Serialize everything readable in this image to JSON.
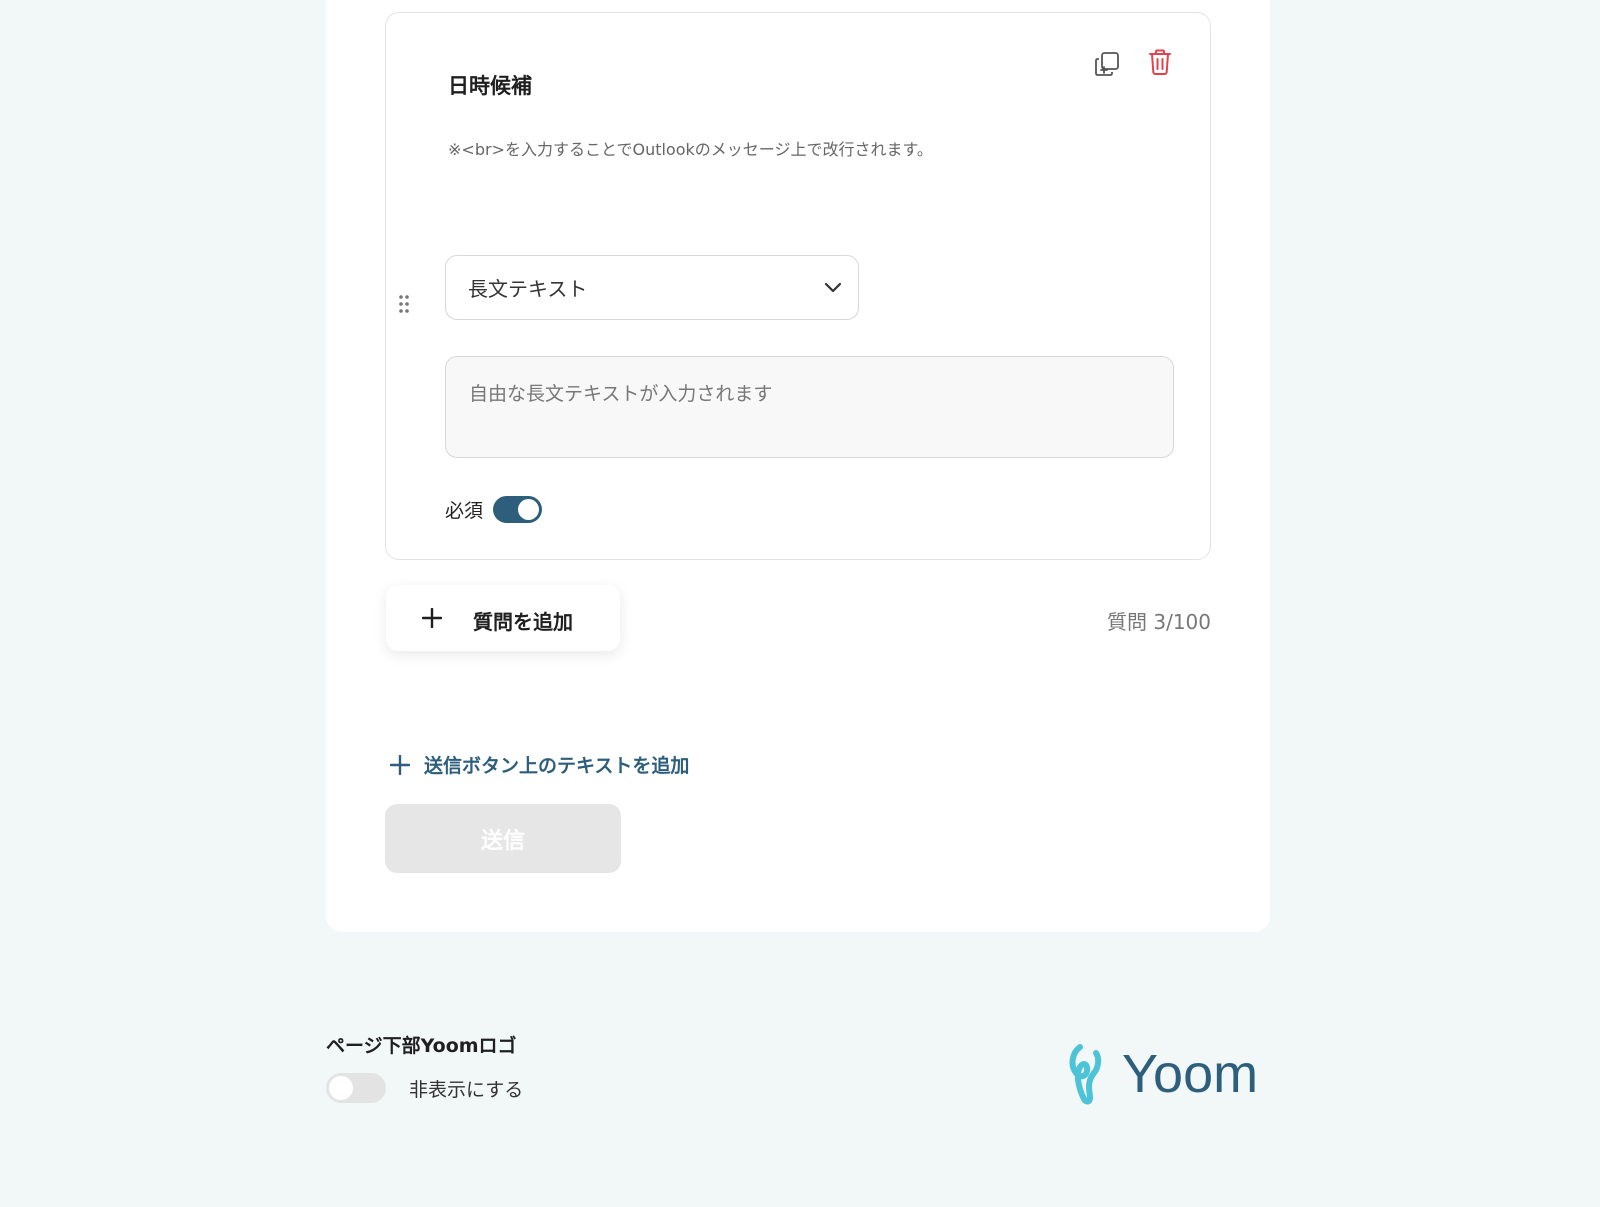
{
  "question": {
    "title": "日時候補",
    "description": "※<br>を入力することでOutlookのメッセージ上で改行されます。",
    "type_selected": "長文テキスト",
    "answer_placeholder": "自由な長文テキストが入力されます",
    "required_label": "必須",
    "required": true
  },
  "actions": {
    "add_question_label": "質問を追加",
    "question_count": "質問 3/100",
    "add_text_above_submit_label": "送信ボタン上のテキストを追加",
    "submit_label": "送信"
  },
  "footer": {
    "logo_setting_title": "ページ下部Yoomロゴ",
    "hide_label": "非表示にする",
    "hide_enabled": false,
    "brand_name": "Yoom"
  },
  "colors": {
    "accent": "#2d5f7c",
    "danger": "#e0434b",
    "logo_mark": "#4cc3d6"
  },
  "icons": [
    "copy-icon",
    "trash-icon",
    "drag-handle-icon",
    "chevron-down-icon",
    "plus-icon"
  ]
}
